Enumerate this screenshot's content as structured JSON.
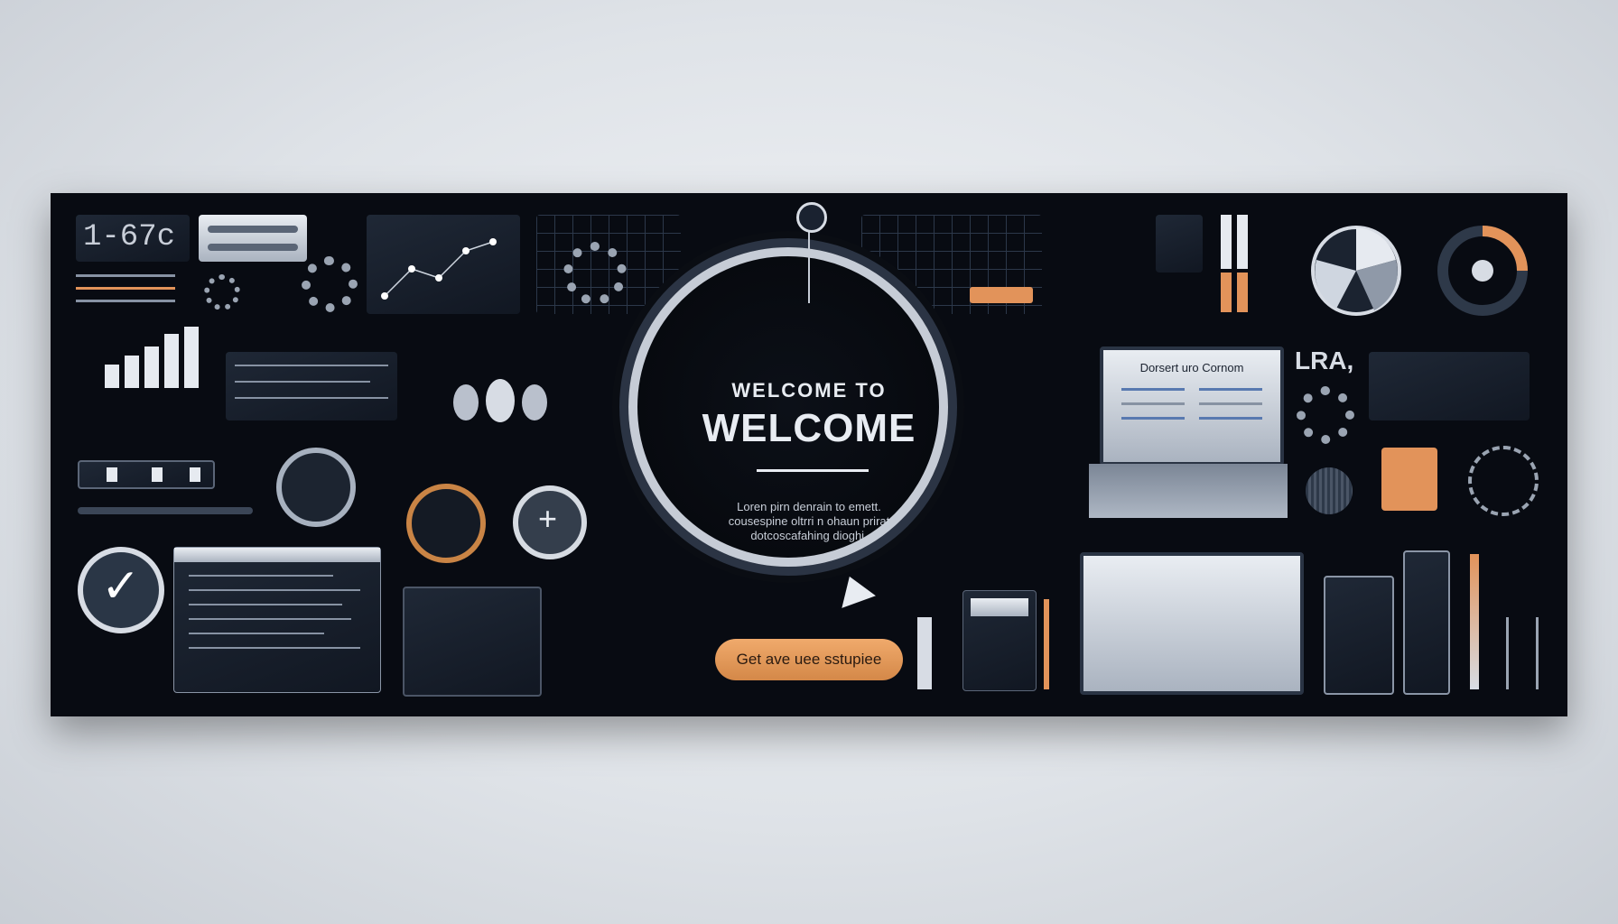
{
  "banner": {
    "heading_small": "WELCOME TO",
    "heading_large": "WELCOME",
    "body_lines": [
      "Loren pirn denrain to emett.",
      "cousespine oltrri n ohaun prirat",
      "dotcoscafahing dioghi."
    ],
    "cta_label": "Get ave uee sstupiee"
  },
  "top_left": {
    "counter": "1-67c"
  },
  "laptop": {
    "screen_title": "Dorsert uro Cornom"
  },
  "right": {
    "label": "LRA,"
  },
  "colors": {
    "accent": "#e2935a",
    "background": "#080b12",
    "panel": "#1a2230"
  }
}
